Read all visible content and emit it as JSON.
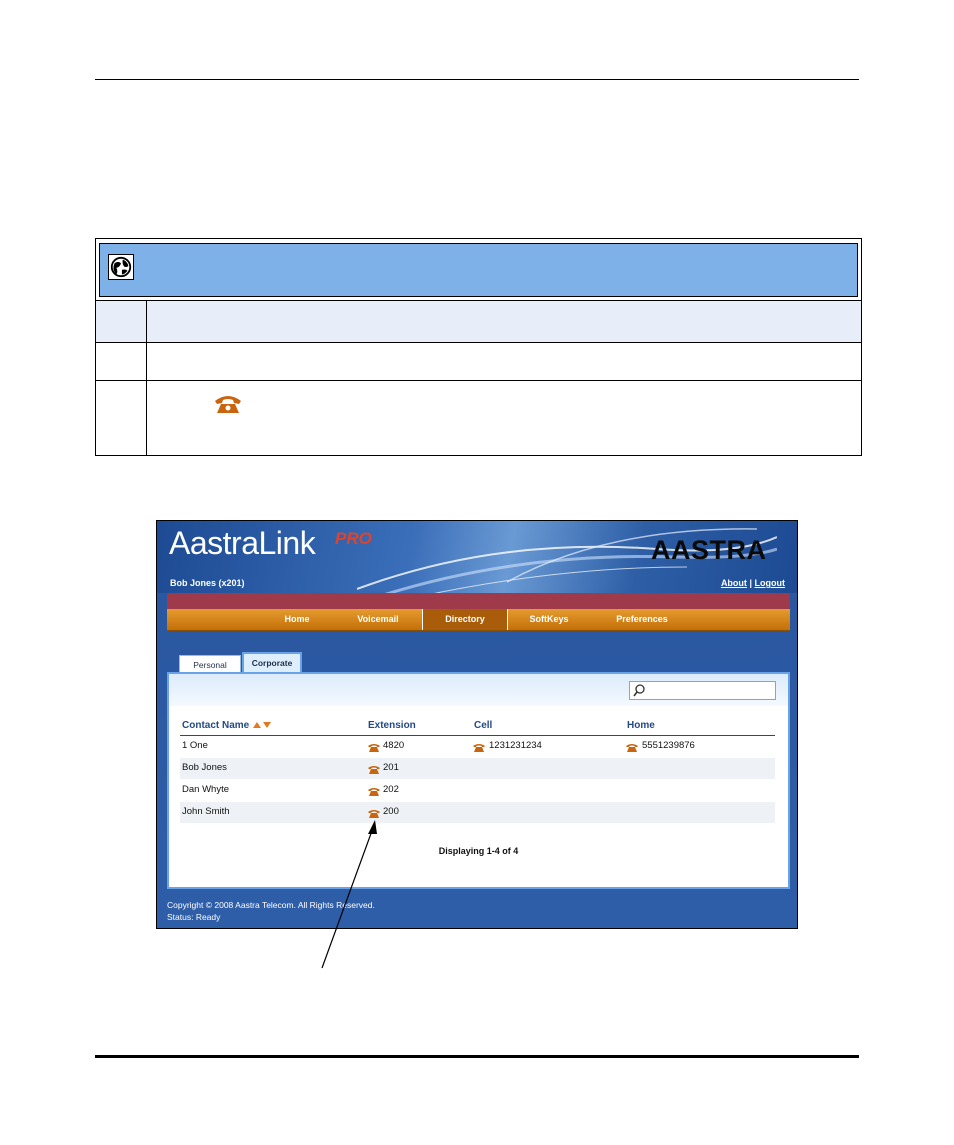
{
  "app": {
    "logo": "AastraLink",
    "logo_suffix": "PRO",
    "brand": "AASTRA",
    "user": "Bob Jones (x201)",
    "links": {
      "about": "About",
      "separator": "|",
      "logout": "Logout"
    }
  },
  "nav": {
    "items": [
      "Home",
      "Voicemail",
      "Directory",
      "SoftKeys",
      "Preferences"
    ],
    "active": "Directory"
  },
  "tabs": {
    "personal": "Personal",
    "corporate": "Corporate",
    "active": "Corporate"
  },
  "search": {
    "value": "",
    "placeholder": ""
  },
  "table": {
    "headers": {
      "name": "Contact Name",
      "extension": "Extension",
      "cell": "Cell",
      "home": "Home"
    },
    "rows": [
      {
        "name": "1 One",
        "extension": "4820",
        "cell": "1231231234",
        "home": "5551239876"
      },
      {
        "name": "Bob Jones",
        "extension": "201",
        "cell": "",
        "home": ""
      },
      {
        "name": "Dan Whyte",
        "extension": "202",
        "cell": "",
        "home": ""
      },
      {
        "name": "John Smith",
        "extension": "200",
        "cell": "",
        "home": ""
      }
    ]
  },
  "paging": "Displaying 1-4 of 4",
  "footer": {
    "copyright": "Copyright © 2008 Aastra Telecom. All Rights Reserved.",
    "status": "Status: Ready"
  },
  "colors": {
    "page_blue": "#2f5ea8",
    "nav_orange": "#d9861a",
    "header_bar": "#9f3a4b",
    "phone_icon": "#c8650e",
    "procedure_header": "#7eb1e8"
  },
  "icons": {
    "procedure_header": "globe-icon",
    "procedure_step": "phone-icon",
    "search": "search-icon",
    "sort": "sort-arrows-icon",
    "number": "phone-icon"
  }
}
